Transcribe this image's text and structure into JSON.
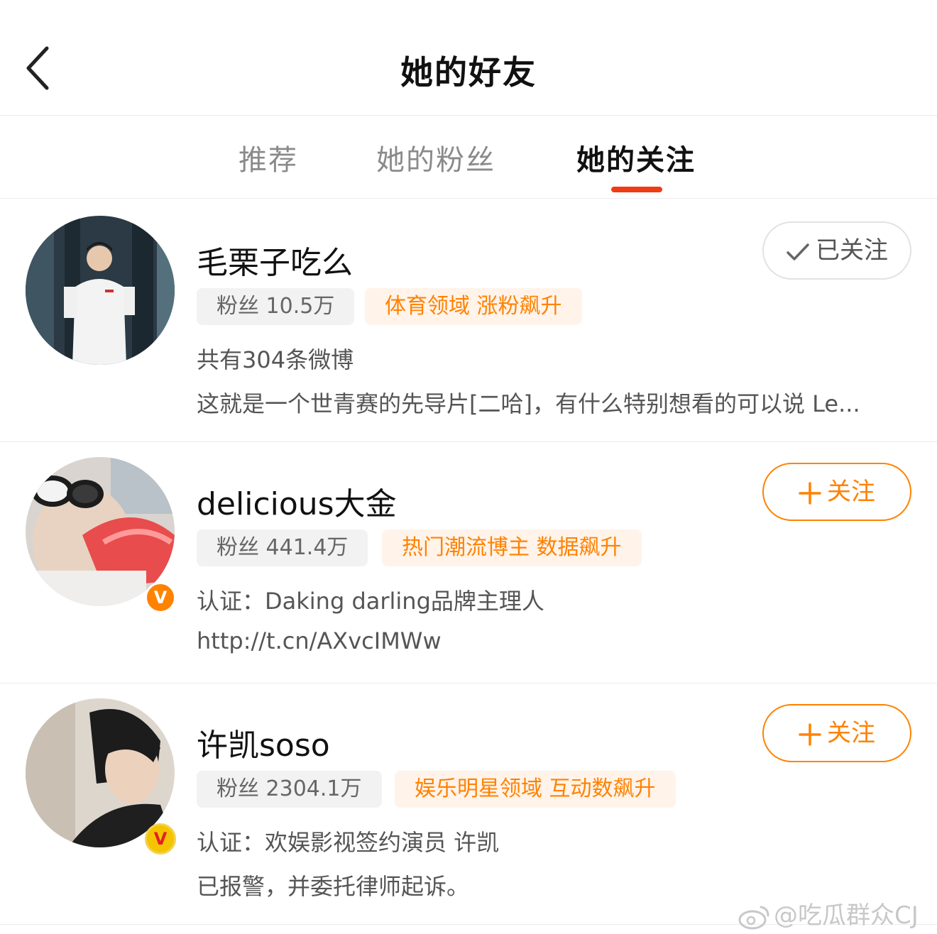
{
  "header": {
    "title": "她的好友"
  },
  "tabs": [
    {
      "label": "推荐"
    },
    {
      "label": "她的粉丝"
    },
    {
      "label": "她的关注"
    }
  ],
  "colors": {
    "accent": "#f03c14",
    "orange": "#ff8200",
    "tag_bg": "#fff3ea"
  },
  "users": [
    {
      "name": "毛栗子吃么",
      "fans": "粉丝 10.5万",
      "tag": "体育领域 涨粉飙升",
      "line1": "共有304条微博",
      "line2": "这就是一个世青赛的先导片[二哈]，有什么特别想看的可以说 Le...",
      "button_label": "已关注",
      "button_icon": "check-icon",
      "verified": false
    },
    {
      "name": "delicious大金",
      "fans": "粉丝 441.4万",
      "tag": "热门潮流博主 数据飙升",
      "line1": "认证：Daking darling品牌主理人",
      "line2": "http://t.cn/AXvcIMWw",
      "button_label": "关注",
      "button_icon": "plus-icon",
      "verified": true,
      "badge_letter": "V"
    },
    {
      "name": "许凯soso",
      "fans": "粉丝 2304.1万",
      "tag": "娱乐明星领域 互动数飙升",
      "line1": "认证：欢娱影视签约演员 许凯",
      "line2": "已报警，并委托律师起诉。",
      "button_label": "关注",
      "button_icon": "plus-icon",
      "verified": true,
      "badge_letter": "V"
    }
  ],
  "watermark": {
    "text": "@吃瓜群众CJ"
  }
}
